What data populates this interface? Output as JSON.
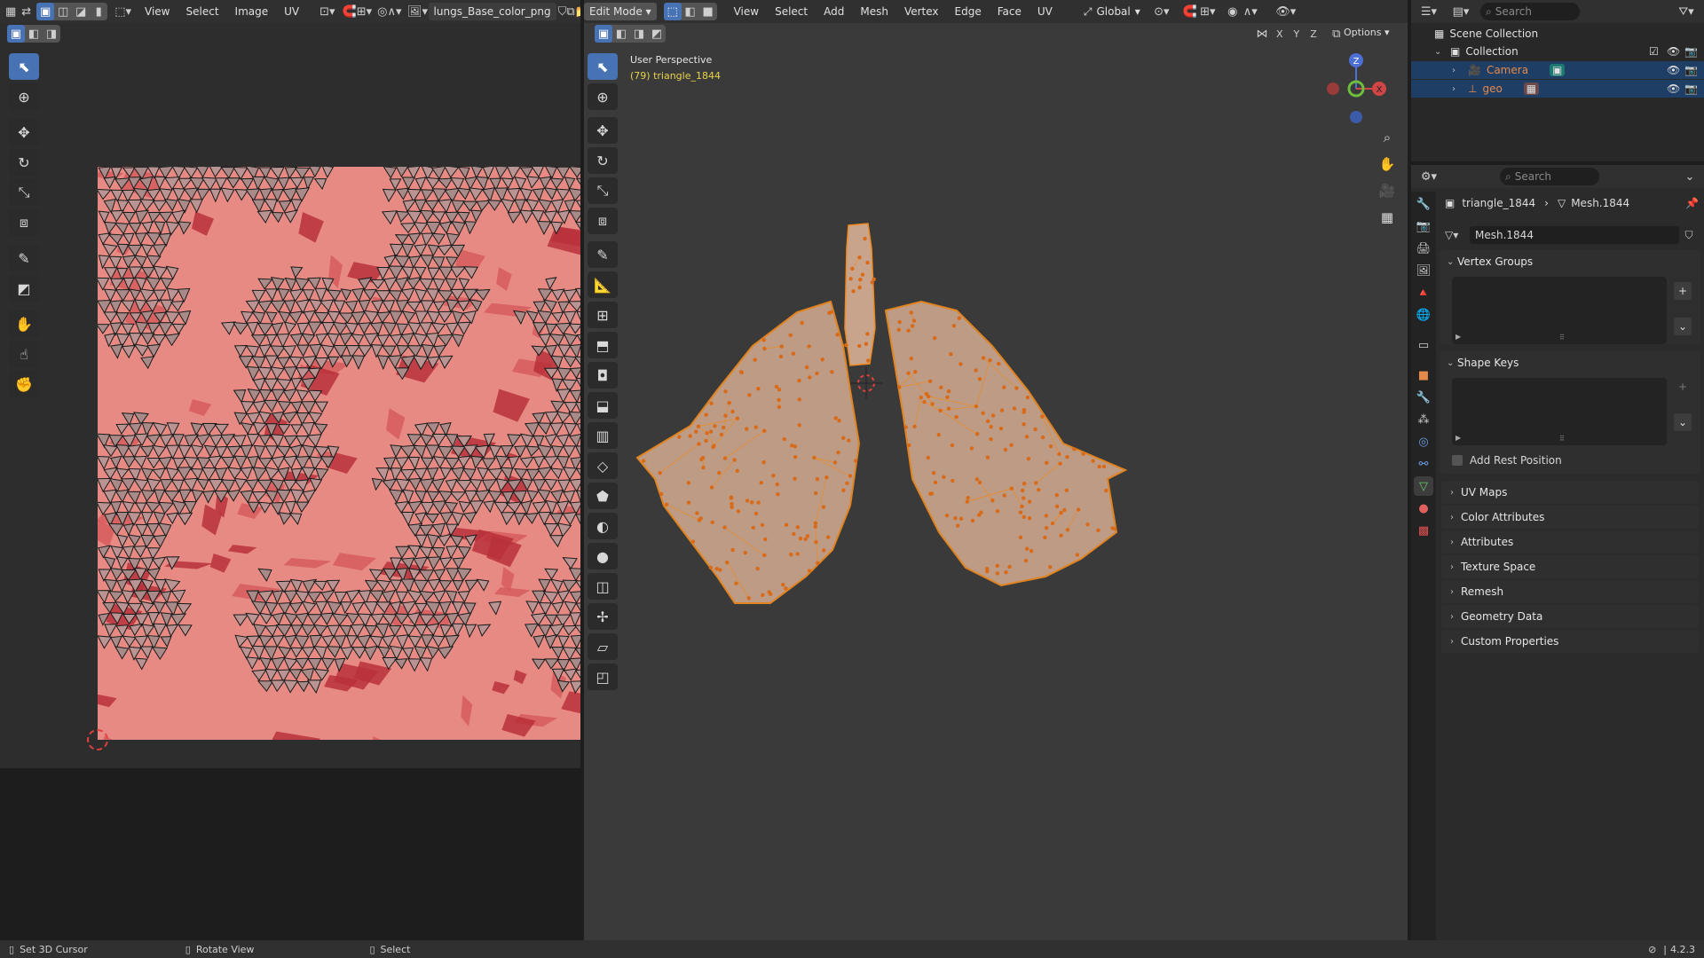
{
  "uv_editor": {
    "menu": [
      "View",
      "Select",
      "Image",
      "UV"
    ],
    "image_name": "lungs_Base_color_png"
  },
  "viewport": {
    "mode": "Edit Mode",
    "menu": [
      "View",
      "Select",
      "Add",
      "Mesh",
      "Vertex",
      "Edge",
      "Face",
      "UV"
    ],
    "transform_orientation": "Global",
    "perspective": "User Perspective",
    "object_info": "(79) triangle_1844",
    "axis_x": "X",
    "axis_y": "Y",
    "axis_z": "Z",
    "options_label": "Options"
  },
  "outliner": {
    "search_placeholder": "Search",
    "scene_collection": "Scene Collection",
    "collection": "Collection",
    "items": [
      "Camera",
      "geo"
    ]
  },
  "properties": {
    "search_placeholder": "Search",
    "breadcrumb_object": "triangle_1844",
    "breadcrumb_mesh": "Mesh.1844",
    "mesh_name": "Mesh.1844",
    "panels": {
      "vertex_groups": "Vertex Groups",
      "shape_keys": "Shape Keys",
      "add_rest_position": "Add Rest Position",
      "uv_maps": "UV Maps",
      "color_attributes": "Color Attributes",
      "attributes": "Attributes",
      "texture_space": "Texture Space",
      "remesh": "Remesh",
      "geometry_data": "Geometry Data",
      "custom_properties": "Custom Properties"
    }
  },
  "status": {
    "set_cursor": "Set 3D Cursor",
    "rotate_view": "Rotate View",
    "select": "Select",
    "version": "4.2.3"
  },
  "colors": {
    "accent_blue": "#4772b3",
    "mesh_orange": "#f08a1c",
    "camera_orange": "#e6884a",
    "info_yellow": "#e8d24a"
  }
}
